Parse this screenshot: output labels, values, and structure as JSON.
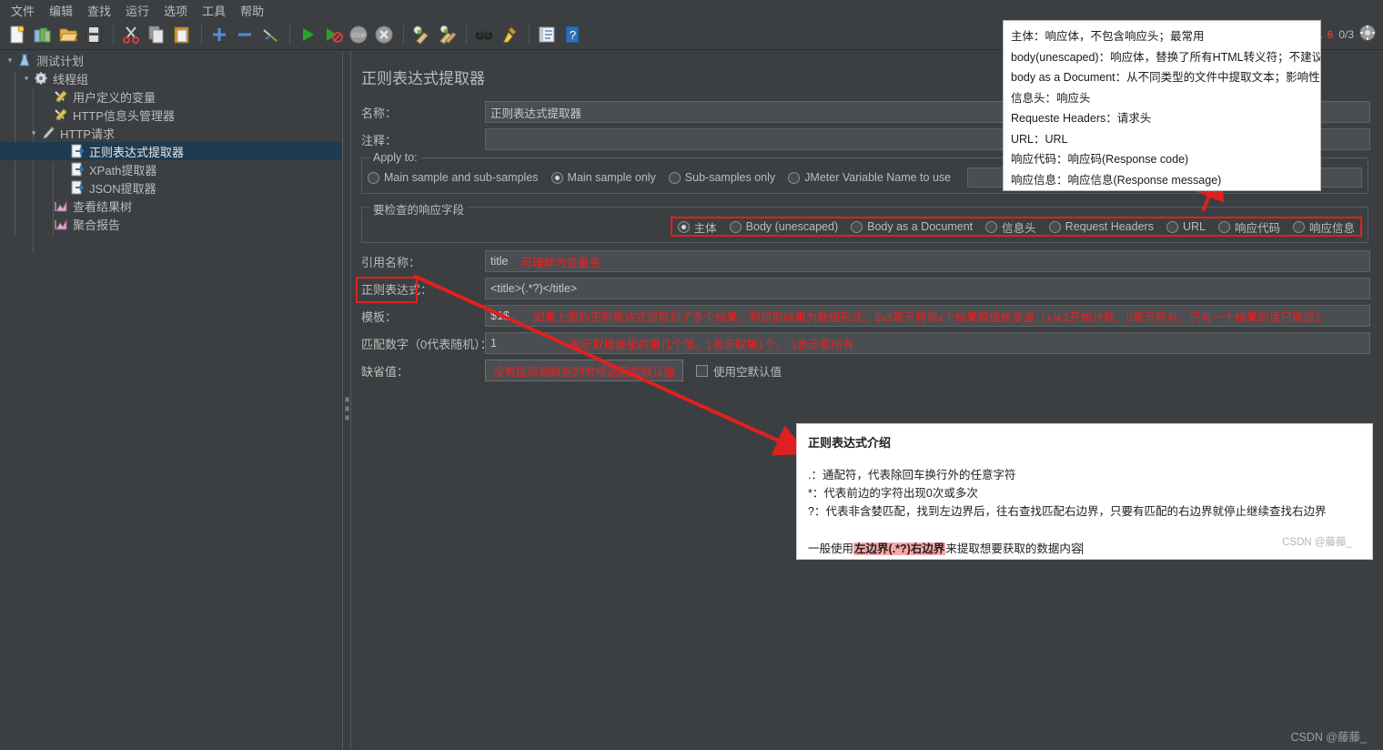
{
  "menubar": {
    "items": [
      "文件",
      "编辑",
      "查找",
      "运行",
      "选项",
      "工具",
      "帮助"
    ]
  },
  "toolbar": {
    "buttons": [
      {
        "name": "new-icon",
        "title": "新建"
      },
      {
        "name": "templates-icon",
        "title": "模板"
      },
      {
        "name": "open-icon",
        "title": "打开"
      },
      {
        "name": "save-icon",
        "title": "保存"
      },
      {
        "name": "cut-icon",
        "title": "剪切"
      },
      {
        "name": "copy-icon",
        "title": "复制"
      },
      {
        "name": "paste-icon",
        "title": "粘贴"
      },
      {
        "name": "expand-icon",
        "title": "展开"
      },
      {
        "name": "collapse-icon",
        "title": "折叠"
      },
      {
        "name": "toggle-icon",
        "title": "启用/禁用"
      },
      {
        "name": "start-icon",
        "title": "启动"
      },
      {
        "name": "start-no-timers-icon",
        "title": "无间隔启动"
      },
      {
        "name": "stop-icon",
        "title": "停止"
      },
      {
        "name": "shutdown-icon",
        "title": "关闭"
      },
      {
        "name": "clear-icon",
        "title": "清除"
      },
      {
        "name": "clear-all-icon",
        "title": "清除全部"
      },
      {
        "name": "search-icon",
        "title": "搜索"
      },
      {
        "name": "reset-search-icon",
        "title": "重置搜索"
      },
      {
        "name": "function-helper-icon",
        "title": "函数助手"
      },
      {
        "name": "help-icon",
        "title": "帮助"
      }
    ],
    "warning_count": "6",
    "thread_count": "0/3",
    "gear_name": "connect-icon"
  },
  "tree": {
    "items": [
      {
        "label": "测试计划",
        "indent": 0,
        "arrow": "down",
        "icon": "test-plan-icon",
        "selected": false
      },
      {
        "label": "线程组",
        "indent": 1,
        "arrow": "down",
        "icon": "thread-group-icon",
        "selected": false
      },
      {
        "label": "用户定义的变量",
        "indent": 2,
        "arrow": "none",
        "icon": "config-icon",
        "selected": false
      },
      {
        "label": "HTTP信息头管理器",
        "indent": 2,
        "arrow": "none",
        "icon": "config-icon",
        "selected": false
      },
      {
        "label": "HTTP请求",
        "indent": 2,
        "arrow": "down",
        "icon": "sampler-icon",
        "selected": false
      },
      {
        "label": "正则表达式提取器",
        "indent": 3,
        "arrow": "none",
        "icon": "postproc-icon",
        "selected": true
      },
      {
        "label": "XPath提取器",
        "indent": 3,
        "arrow": "none",
        "icon": "postproc-icon",
        "selected": false
      },
      {
        "label": "JSON提取器",
        "indent": 3,
        "arrow": "none",
        "icon": "postproc-icon",
        "selected": false
      },
      {
        "label": "查看结果树",
        "indent": 2,
        "arrow": "none",
        "icon": "listener-icon",
        "selected": false
      },
      {
        "label": "聚合报告",
        "indent": 2,
        "arrow": "none",
        "icon": "listener-icon",
        "selected": false
      }
    ]
  },
  "main": {
    "title": "正则表达式提取器",
    "name_label": "名称：",
    "name_value": "正则表达式提取器",
    "comment_label": "注释：",
    "comment_value": "",
    "apply_to": {
      "title": "Apply to:",
      "options": [
        {
          "label": "Main sample and sub-samples",
          "checked": false
        },
        {
          "label": "Main sample only",
          "checked": true
        },
        {
          "label": "Sub-samples only",
          "checked": false
        },
        {
          "label": "JMeter Variable Name to use",
          "checked": false
        }
      ],
      "variable_value": ""
    },
    "response_field": {
      "title": "要检查的响应字段",
      "options": [
        {
          "label": "主体",
          "checked": true
        },
        {
          "label": "Body (unescaped)",
          "checked": false
        },
        {
          "label": "Body as a Document",
          "checked": false
        },
        {
          "label": "信息头",
          "checked": false
        },
        {
          "label": "Request Headers",
          "checked": false
        },
        {
          "label": "URL",
          "checked": false
        },
        {
          "label": "响应代码",
          "checked": false
        },
        {
          "label": "响应信息",
          "checked": false
        }
      ]
    },
    "ref_name_label": "引用名称：",
    "ref_name_value": "title",
    "ref_name_note": "可理解为变量名",
    "regex_label": "正则表达式",
    "regex_label_colon": "：",
    "regex_value": "<title>(.*?)</title>",
    "template_label": "模板：",
    "template_value": "$1$",
    "template_note": "如果上面的正则表达式提取到了多个结果，则提取结果为数组形式。$x$表示将第x个结果赋值给变量（x从1开始计数，0表示所有，只有一个结果的话只能是1",
    "match_label": "匹配数字（0代表随机）：",
    "match_value": "1",
    "match_note": "表示取模板里的第几个值。1表示取第1个，-1表示取所有",
    "default_label": "缺省值：",
    "default_placeholder": "没有提取到数据的时候返回的默认值",
    "use_empty_label": "使用空默认值",
    "use_empty_checked": false
  },
  "tooltip": {
    "lines": [
      "主体：响应体，不包含响应头；最常用",
      "body(unescaped)：响应体，替换了所有HTML转义符；不建议使用",
      "body as a Document：从不同类型的文件中提取文本；影响性能",
      "信息头：响应头",
      "Requeste Headers：请求头",
      "URL：URL",
      "响应代码：响应码(Response code)",
      "响应信息：响应信息(Response message)"
    ]
  },
  "regex_info": {
    "title": "正则表达式介绍",
    "lines": [
      ".：通配符，代表除回车换行外的任意字符",
      "*：代表前边的字符出现0次或多次",
      "?：代表非含婪匹配，找到左边界后，往右查找匹配右边界，只要有匹配的右边界就停止继续查找右边界"
    ],
    "footer_prefix": "一般使用",
    "footer_highlight": "左边界(.*?)右边界",
    "footer_suffix": "来提取想要获取的数据内容",
    "csdn": "CSDN @藤藤_"
  },
  "watermark": "CSDN @藤藤_",
  "colors": {
    "background": "#3c3f41",
    "panel_text": "#bbbbbb",
    "field_bg": "#4a4e51",
    "selection": "#1f3b54",
    "annotation_red": "#e02020",
    "note_red": "#f01f1f"
  }
}
